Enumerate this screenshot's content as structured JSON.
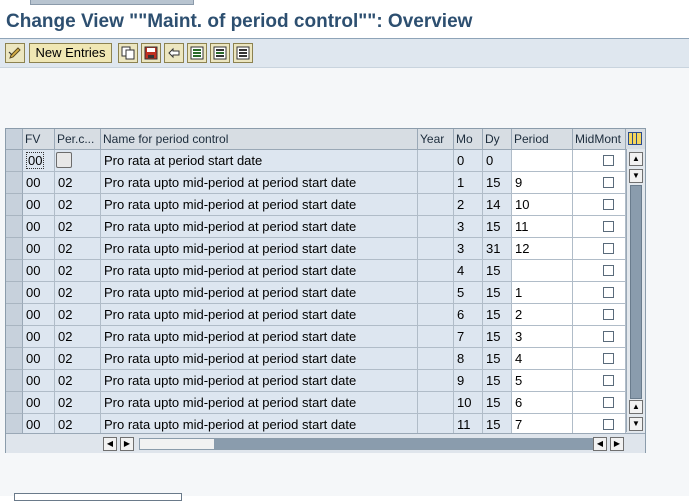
{
  "window": {
    "title": "Change View \"\"Maint. of period control\"\": Overview"
  },
  "toolbar": {
    "new_entries_label": "New Entries",
    "icons": [
      "edit-toggle-icon",
      "copy-icon",
      "save-variant-icon",
      "undo-change-icon",
      "select-all-icon",
      "select-block-icon",
      "deselect-all-icon"
    ]
  },
  "table": {
    "columns": [
      "FV",
      "Per.c...",
      "Name for period control",
      "Year",
      "Mo",
      "Dy",
      "Period",
      "MidMont"
    ],
    "rows": [
      {
        "fv": "00",
        "pc": "",
        "name": "Pro rata at period start date",
        "year": "",
        "mo": "0",
        "dy": "0",
        "period": "",
        "mid": false
      },
      {
        "fv": "00",
        "pc": "02",
        "name": "Pro rata upto mid-period at period start date",
        "year": "",
        "mo": "1",
        "dy": "15",
        "period": "9",
        "mid": false
      },
      {
        "fv": "00",
        "pc": "02",
        "name": "Pro rata upto mid-period at period start date",
        "year": "",
        "mo": "2",
        "dy": "14",
        "period": "10",
        "mid": false
      },
      {
        "fv": "00",
        "pc": "02",
        "name": "Pro rata upto mid-period at period start date",
        "year": "",
        "mo": "3",
        "dy": "15",
        "period": "11",
        "mid": false
      },
      {
        "fv": "00",
        "pc": "02",
        "name": "Pro rata upto mid-period at period start date",
        "year": "",
        "mo": "3",
        "dy": "31",
        "period": "12",
        "mid": false
      },
      {
        "fv": "00",
        "pc": "02",
        "name": "Pro rata upto mid-period at period start date",
        "year": "",
        "mo": "4",
        "dy": "15",
        "period": "",
        "mid": false
      },
      {
        "fv": "00",
        "pc": "02",
        "name": "Pro rata upto mid-period at period start date",
        "year": "",
        "mo": "5",
        "dy": "15",
        "period": "1",
        "mid": false
      },
      {
        "fv": "00",
        "pc": "02",
        "name": "Pro rata upto mid-period at period start date",
        "year": "",
        "mo": "6",
        "dy": "15",
        "period": "2",
        "mid": false
      },
      {
        "fv": "00",
        "pc": "02",
        "name": "Pro rata upto mid-period at period start date",
        "year": "",
        "mo": "7",
        "dy": "15",
        "period": "3",
        "mid": false
      },
      {
        "fv": "00",
        "pc": "02",
        "name": "Pro rata upto mid-period at period start date",
        "year": "",
        "mo": "8",
        "dy": "15",
        "period": "4",
        "mid": false
      },
      {
        "fv": "00",
        "pc": "02",
        "name": "Pro rata upto mid-period at period start date",
        "year": "",
        "mo": "9",
        "dy": "15",
        "period": "5",
        "mid": false
      },
      {
        "fv": "00",
        "pc": "02",
        "name": "Pro rata upto mid-period at period start date",
        "year": "",
        "mo": "10",
        "dy": "15",
        "period": "6",
        "mid": false
      },
      {
        "fv": "00",
        "pc": "02",
        "name": "Pro rata upto mid-period at period start date",
        "year": "",
        "mo": "11",
        "dy": "15",
        "period": "7",
        "mid": false
      }
    ]
  },
  "colors": {
    "title": "#2d4f70",
    "toolbar_bg": "#dfe7ef",
    "readonly_cell": "#dde6f0",
    "scroll_thumb": "#8a9cad"
  }
}
